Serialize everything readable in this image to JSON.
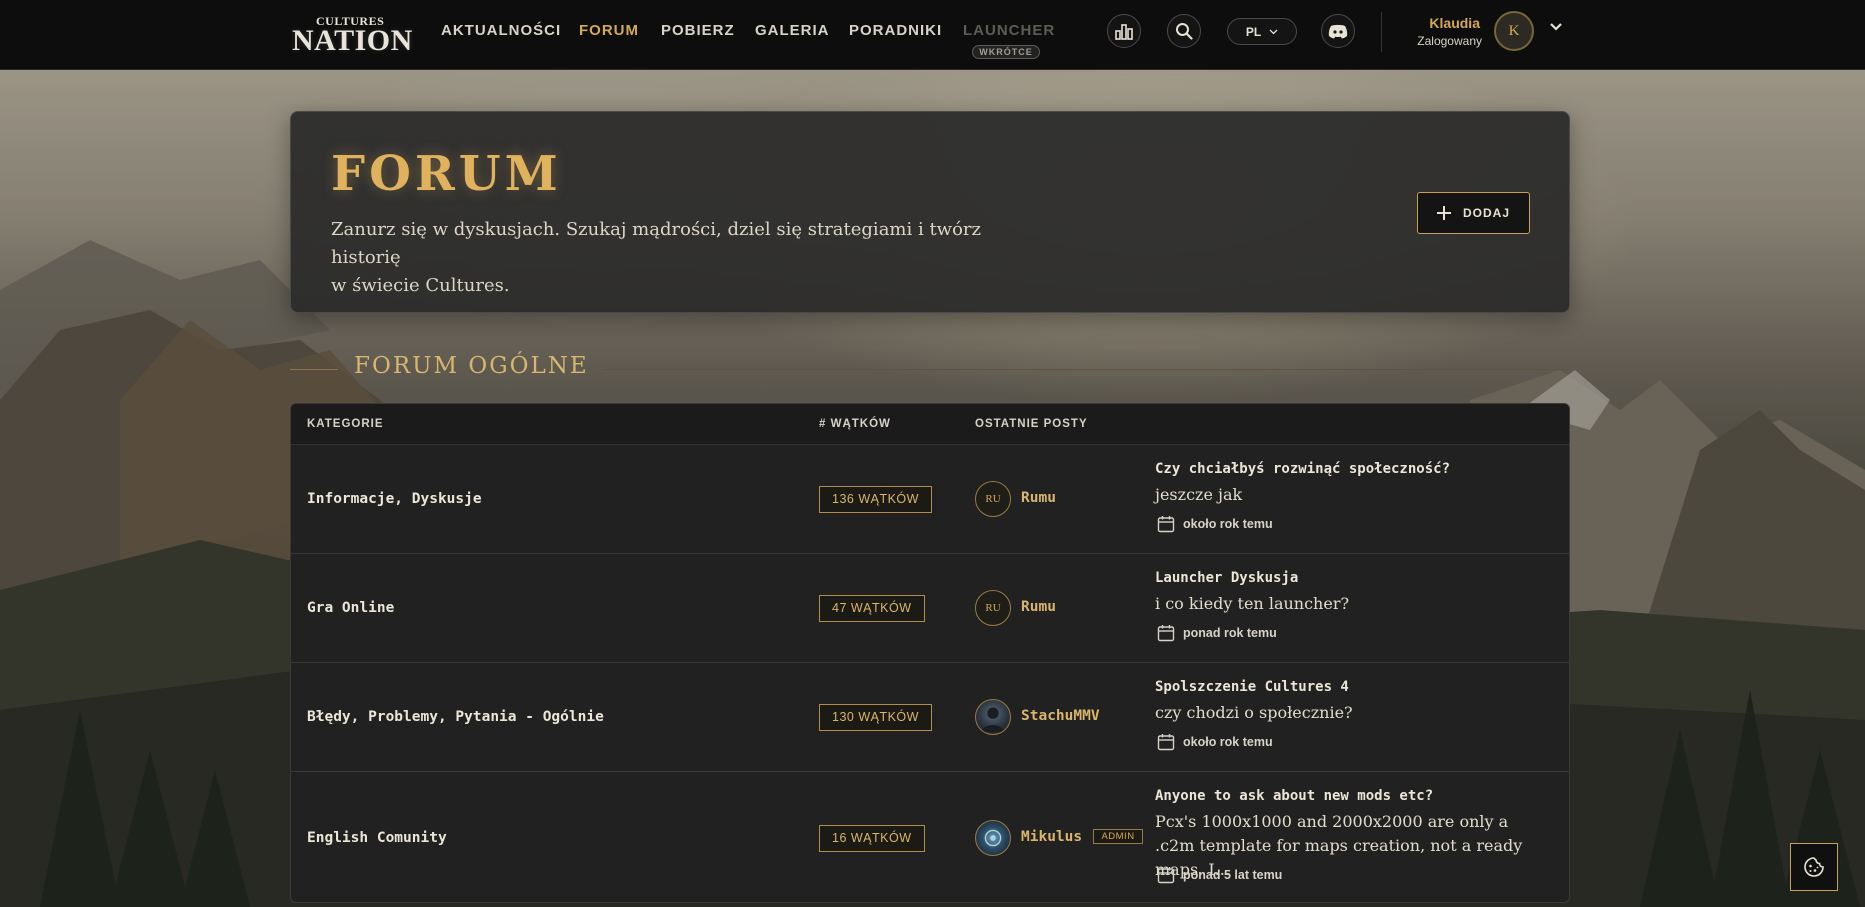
{
  "nav": {
    "logo": {
      "top": "CULTURES",
      "main": "NATION"
    },
    "links": [
      {
        "label": "AKTUALNOŚCI",
        "state": "normal"
      },
      {
        "label": "FORUM",
        "state": "active"
      },
      {
        "label": "POBIERZ",
        "state": "normal"
      },
      {
        "label": "GALERIA",
        "state": "normal"
      },
      {
        "label": "PORADNIKI",
        "state": "normal"
      },
      {
        "label": "LAUNCHER",
        "state": "disabled"
      }
    ],
    "launcher_badge": "WKRÓTCE",
    "icons": [
      "stats-icon",
      "search-icon",
      "discord-icon"
    ],
    "language": "PL",
    "user": {
      "name": "Klaudia",
      "status": "Zalogowany",
      "initial": "K"
    }
  },
  "hero": {
    "title": "FORUM",
    "subtitle_line1": "Zanurz się w dyskusjach. Szukaj mądrości, dziel się strategiami i twórz historię",
    "subtitle_line2": "w świecie Cultures.",
    "add_button": "DODAJ"
  },
  "section": {
    "title": "FORUM OGÓLNE"
  },
  "table": {
    "headers": {
      "categories": "KATEGORIE",
      "threads": "# WĄTKÓW",
      "latest": "OSTATNIE POSTY"
    },
    "rows": [
      {
        "category": "Informacje, Dyskusje",
        "threads": "136 WĄTKÓW",
        "avatar": "RU",
        "poster": "Rumu",
        "admin": "",
        "post_title": "Czy chciałbyś rozwinąć społeczność?",
        "post_text": "jeszcze jak",
        "post_time": "około rok temu"
      },
      {
        "category": "Gra Online",
        "threads": "47 WĄTKÓW",
        "avatar": "RU",
        "poster": "Rumu",
        "admin": "",
        "post_title": "Launcher Dyskusja",
        "post_text": "i co kiedy ten launcher?",
        "post_time": "ponad rok temu"
      },
      {
        "category": "Błędy, Problemy, Pytania - Ogólnie",
        "threads": "130 WĄTKÓW",
        "avatar": "",
        "poster": "StachuMMV",
        "admin": "",
        "post_title": "Spolszczenie Cultures 4",
        "post_text": "czy chodzi o społecznie?",
        "post_time": "około rok temu"
      },
      {
        "category": "English Comunity",
        "threads": "16 WĄTKÓW",
        "avatar": "",
        "poster": "Mikulus",
        "admin": "ADMIN",
        "post_title": "Anyone to ask about new mods etc?",
        "post_text": "Pcx's 1000x1000 and 2000x2000 are only a .c2m template for maps creation, not a ready maps. I...",
        "post_time": "ponad 5 lat temu"
      }
    ]
  },
  "colors": {
    "accent": "#d4a955",
    "bg_dark": "#0d0d0d",
    "panel": "#212121"
  }
}
